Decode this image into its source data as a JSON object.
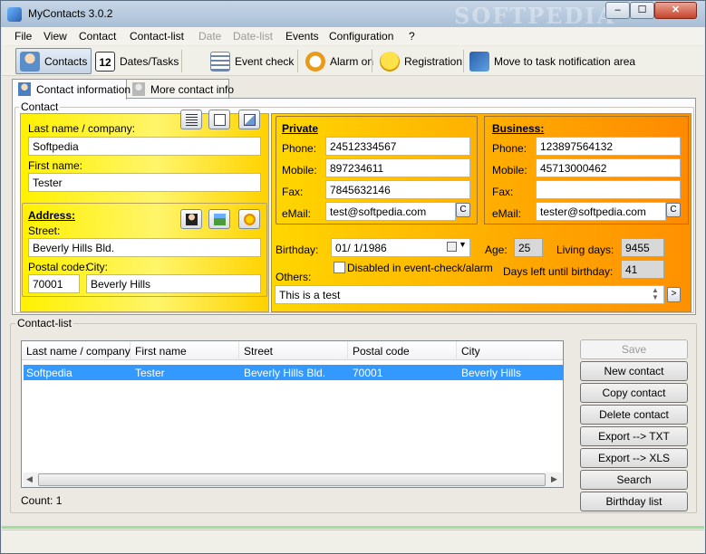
{
  "window": {
    "title": "MyContacts 3.0.2",
    "watermark": "SOFTPEDIA",
    "min_glyph": "–",
    "max_glyph": "☐",
    "close_glyph": "✕"
  },
  "menu": {
    "items": [
      "File",
      "View",
      "Contact",
      "Contact-list",
      "Date",
      "Date-list",
      "Events",
      "Configuration",
      "?"
    ]
  },
  "toolbar": {
    "contacts": "Contacts",
    "dates_tasks": "Dates/Tasks",
    "calendar_day": "12",
    "event_check": "Event check",
    "alarm_on": "Alarm on",
    "registration": "Registration",
    "move_to_tray": "Move to task notification area"
  },
  "tabs": {
    "contact_information": "Contact information",
    "more_contact_info": "More contact info"
  },
  "contact": {
    "group_label": "Contact",
    "last_name_label": "Last name / company:",
    "last_name_value": "Softpedia",
    "first_name_label": "First name:",
    "first_name_value": "Tester",
    "address": {
      "heading": "Address:",
      "street_label": "Street:",
      "street_value": "Beverly Hills Bld.",
      "postal_label": "Postal code:",
      "city_label": "City:",
      "postal_value": "70001",
      "city_value": "Beverly Hills"
    },
    "private": {
      "heading": "Private",
      "phone_label": "Phone:",
      "phone_value": "24512334567",
      "mobile_label": "Mobile:",
      "mobile_value": "897234611",
      "fax_label": "Fax:",
      "fax_value": "7845632146",
      "email_label": "eMail:",
      "email_value": "test@softpedia.com"
    },
    "business": {
      "heading": "Business:",
      "phone_label": "Phone:",
      "phone_value": "123897564132",
      "mobile_label": "Mobile:",
      "mobile_value": "45713000462",
      "fax_label": "Fax:",
      "fax_value": "",
      "email_label": "eMail:",
      "email_value": "tester@softpedia.com"
    },
    "c_button": "C",
    "birthday_label": "Birthday:",
    "birthday_value": "01/  1/1986",
    "age_label": "Age:",
    "age_value": "25",
    "living_days_label": "Living days:",
    "living_days_value": "9455",
    "days_left_label": "Days left until birthday:",
    "days_left_value": "41",
    "disabled_check_label": "Disabled in event-check/alarm",
    "others_label": "Others:",
    "others_value": "This is a test",
    "expand_glyph": ">"
  },
  "contact_list": {
    "group_label": "Contact-list",
    "columns": [
      "Last name / company",
      "First name",
      "Street",
      "Postal code",
      "City"
    ],
    "rows": [
      [
        "Softpedia",
        "Tester",
        "Beverly Hills Bld.",
        "70001",
        "Beverly Hills"
      ]
    ],
    "count_label": "Count: 1"
  },
  "side_buttons": {
    "save": "Save",
    "new_contact": "New contact",
    "copy_contact": "Copy contact",
    "delete_contact": "Delete contact",
    "export_txt": "Export --> TXT",
    "export_xls": "Export --> XLS",
    "search": "Search",
    "birthday_list": "Birthday list"
  },
  "colors": {
    "yellow_panel": "#fff100",
    "orange_panel": "#ffa800",
    "selection": "#3399ff"
  }
}
